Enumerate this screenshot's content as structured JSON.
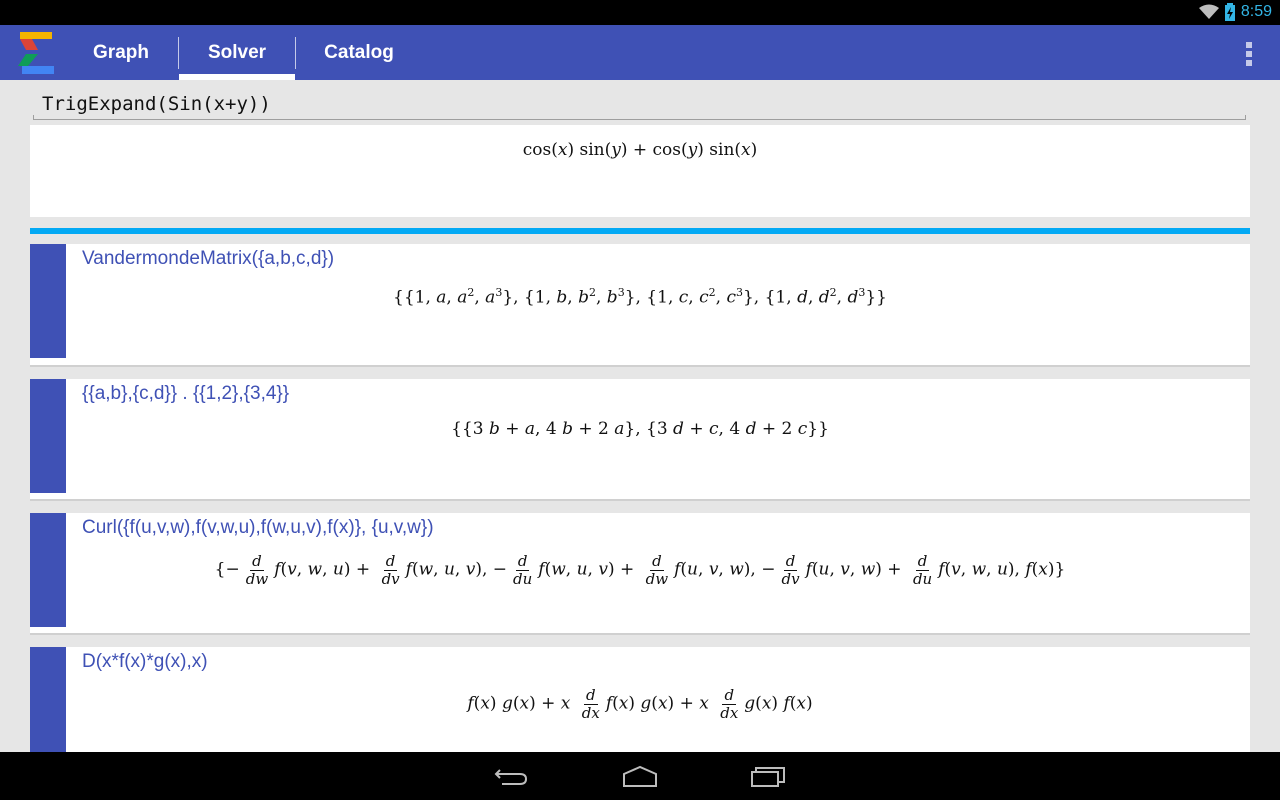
{
  "status_bar": {
    "time": "8:59",
    "icons": [
      "wifi-icon",
      "battery-charging-icon"
    ]
  },
  "app_bar": {
    "logo": "sigma-logo",
    "tabs": [
      {
        "label": "Graph",
        "active": false
      },
      {
        "label": "Solver",
        "active": true
      },
      {
        "label": "Catalog",
        "active": false
      }
    ],
    "overflow_icon": "more-vert-icon"
  },
  "solver": {
    "input_value": "TrigExpand(Sin(x+y))",
    "result": "cos(x) sin(y) + cos(y) sin(x)",
    "accent_color": "#03a9f4"
  },
  "history": [
    {
      "query": "VandermondeMatrix({a,b,c,d})",
      "result": "{{1,a,a^2,a^3},{1,b,b^2,b^3},{1,c,c^2,c^3},{1,d,d^2,d^3}}"
    },
    {
      "query": "{{a,b},{c,d}} . {{1,2},{3,4}}",
      "result": "{{3b+a,4b+2a},{3d+c,4d+2c}}"
    },
    {
      "query": "Curl({f(u,v,w),f(v,w,u),f(w,u,v),f(x)}, {u,v,w})",
      "result": "{-d/dw f(v,w,u) + d/dv f(w,u,v), -d/du f(w,u,v) + d/dw f(u,v,w), -d/dv f(u,v,w) + d/du f(v,w,u), f(x)}"
    },
    {
      "query": "D(x*f(x)*g(x),x)",
      "result": "f(x) g(x) + x d/dx f(x) g(x) + x d/dx g(x) f(x)"
    }
  ],
  "nav_bar": {
    "buttons": [
      "back-icon",
      "home-icon",
      "recents-icon"
    ]
  },
  "colors": {
    "primary": "#3f51b5",
    "accent": "#03a9f4",
    "background": "#e6e6e6"
  }
}
